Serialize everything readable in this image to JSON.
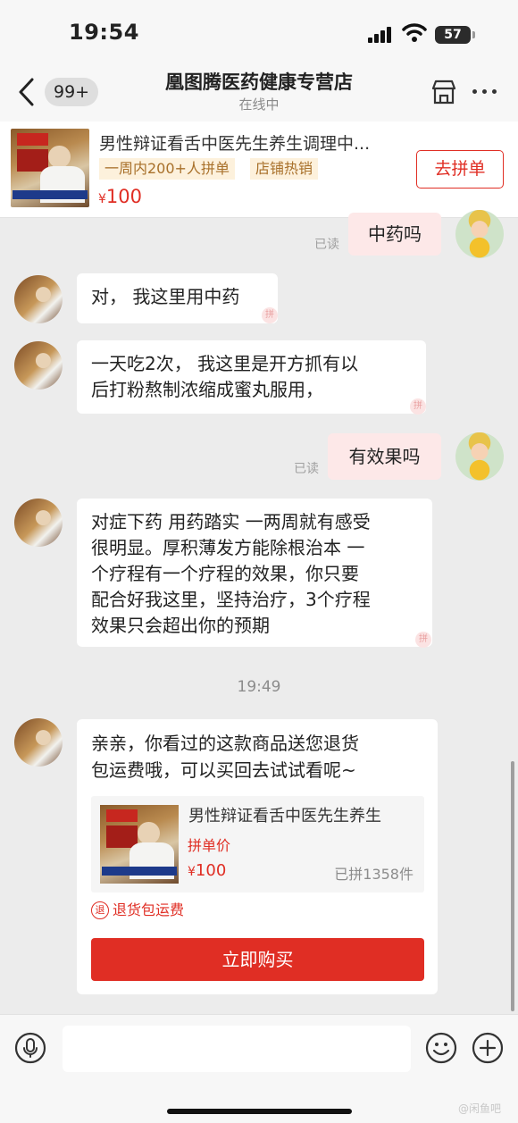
{
  "status_bar": {
    "time": "19:54",
    "battery": "57"
  },
  "nav": {
    "back_badge": "99+",
    "title": "凰图腾医药健康专营店",
    "status": "在线中"
  },
  "product": {
    "name": "男性辩证看舌中医先生养生调理中...",
    "tags": [
      "一周内200+人拼单",
      "店铺热销"
    ],
    "currency": "¥",
    "price": "100",
    "button": "去拼单"
  },
  "messages": [
    {
      "side": "out",
      "text": "中药吗",
      "read": "已读"
    },
    {
      "side": "in",
      "text": "对， 我这里用中药"
    },
    {
      "side": "in",
      "lines": [
        "一天吃2次，  我这里是开方抓有以",
        "后打粉熬制浓缩成蜜丸服用，"
      ]
    },
    {
      "side": "out",
      "text": "有效果吗",
      "read": "已读"
    },
    {
      "side": "in",
      "lines": [
        "对症下药 用药踏实 一两周就有感受",
        "很明显。厚积薄发方能除根治本 一",
        "个疗程有一个疗程的效果，你只要",
        "配合好我这里，坚持治疗，3个疗程",
        "效果只会超出你的预期"
      ]
    }
  ],
  "timestamp": "19:49",
  "card": {
    "lines": [
      "亲亲，你看过的这款商品送您退货",
      "包运费哦，可以买回去试试看呢~"
    ],
    "goods_name": "男性辩证看舌中医先生养生",
    "goods_label": "拼单价",
    "currency": "¥",
    "goods_price": "100",
    "goods_sold": "已拼1358件",
    "refund_badge": "退",
    "refund_text": "退货包运费",
    "buy_button": "立即购买"
  },
  "input": {
    "placeholder": ""
  },
  "watermark": "@闲鱼吧",
  "colors": {
    "accent": "#e02e24",
    "tag_bg": "#fdf1dc",
    "tag_text": "#a8702a",
    "chat_bg": "#ececec",
    "out_bubble": "#fde8e8"
  }
}
